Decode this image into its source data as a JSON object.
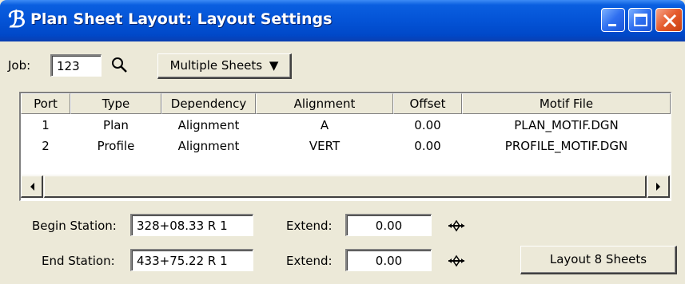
{
  "window": {
    "title": "Plan Sheet Layout: Layout Settings",
    "app_icon": "ℬ",
    "controls": [
      "minimize-icon",
      "maximize-icon",
      "close-icon"
    ],
    "close_color": "#e55a2c",
    "titlebar_color": "#0453d6"
  },
  "job": {
    "label": "Job:",
    "value": "123",
    "lookup_icon": "search-icon"
  },
  "mode_dropdown": {
    "selected": "Multiple Sheets",
    "arrow": "▼"
  },
  "table": {
    "columns": [
      "Port",
      "Type",
      "Dependency",
      "Alignment",
      "Offset",
      "Motif File"
    ],
    "rows": [
      {
        "port": "1",
        "type": "Plan",
        "dependency": "Alignment",
        "alignment": "A",
        "offset": "0.00",
        "motif": "PLAN_MOTIF.DGN"
      },
      {
        "port": "2",
        "type": "Profile",
        "dependency": "Alignment",
        "alignment": "VERT",
        "offset": "0.00",
        "motif": "PROFILE_MOTIF.DGN"
      }
    ]
  },
  "begin_station": {
    "label": "Begin Station:",
    "value": "328+08.33 R 1",
    "extend_label": "Extend:",
    "extend_value": "0.00",
    "pick_icon": "crosshair-icon"
  },
  "end_station": {
    "label": "End Station:",
    "value": "433+75.22 R 1",
    "extend_label": "Extend:",
    "extend_value": "0.00",
    "pick_icon": "crosshair-icon"
  },
  "layout_button": {
    "label": "Layout 8 Sheets"
  }
}
